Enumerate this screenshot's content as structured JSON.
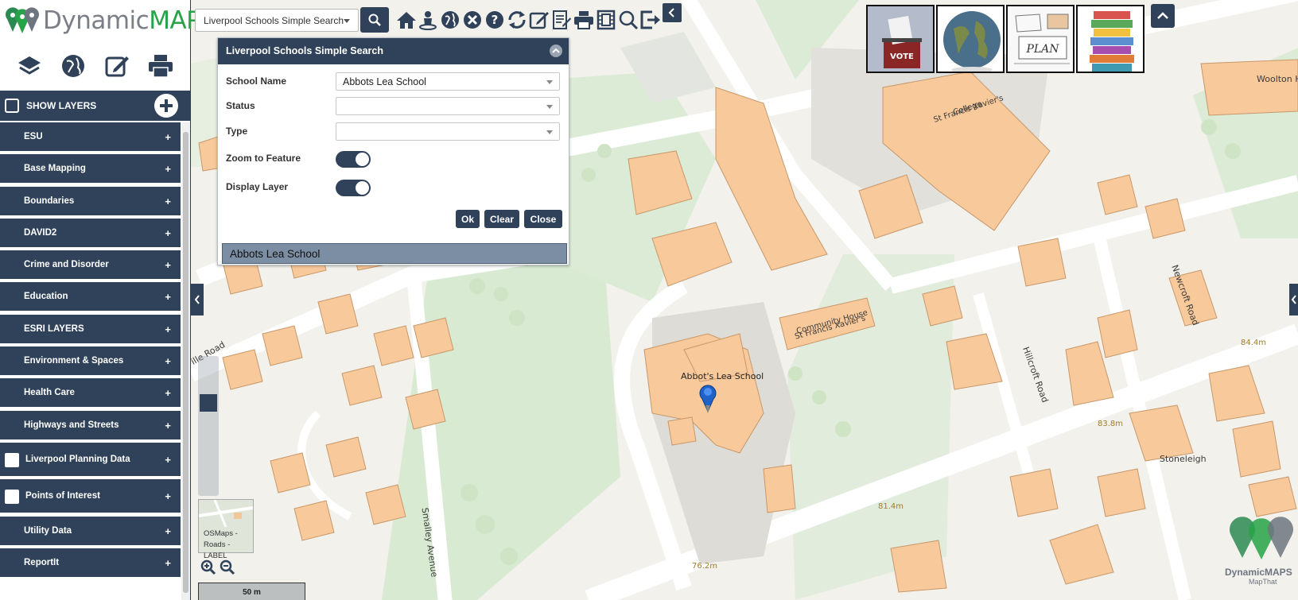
{
  "app": {
    "logo_text_1": "Dynamic",
    "logo_text_2": "MAPS",
    "brand_colors": {
      "navy": "#2f425a",
      "green": "#27a348"
    }
  },
  "toolbar_left": {
    "icons": [
      "layers-icon",
      "globe-icon",
      "edit-icon",
      "print-icon"
    ]
  },
  "show_layers": {
    "label": "SHOW LAYERS"
  },
  "layers": [
    {
      "label": "ESU",
      "checkbox": false
    },
    {
      "label": "Base Mapping",
      "checkbox": false
    },
    {
      "label": "Boundaries",
      "checkbox": false
    },
    {
      "label": "DAVID2",
      "checkbox": false
    },
    {
      "label": "Crime and Disorder",
      "checkbox": false
    },
    {
      "label": "Education",
      "checkbox": false
    },
    {
      "label": "ESRI LAYERS",
      "checkbox": false
    },
    {
      "label": "Environment & Spaces",
      "checkbox": false
    },
    {
      "label": "Health Care",
      "checkbox": false
    },
    {
      "label": "Highways and Streets",
      "checkbox": false
    },
    {
      "label": "Liverpool Planning Data",
      "checkbox": true
    },
    {
      "label": "Points of Interest",
      "checkbox": true
    },
    {
      "label": "Utility Data",
      "checkbox": false
    },
    {
      "label": "ReportIt",
      "checkbox": false
    }
  ],
  "layer_expand_symbol": "+",
  "topbar": {
    "search_selected": "Liverpool Schools Simple Search",
    "icons": [
      "search-icon",
      "home-icon",
      "user-locate-icon",
      "globe-icon",
      "clear-icon",
      "help-icon",
      "refresh-icon",
      "edit-icon",
      "list-edit-icon",
      "print-icon",
      "film-icon",
      "search-map-icon",
      "logout-icon"
    ]
  },
  "thumbnails": [
    {
      "name": "vote-thumbnail",
      "caption": "VOTE"
    },
    {
      "name": "globe-thumbnail",
      "caption": ""
    },
    {
      "name": "plan-thumbnail",
      "caption": "PLAN"
    },
    {
      "name": "books-thumbnail",
      "caption": ""
    }
  ],
  "dialog": {
    "title": "Liverpool Schools Simple Search",
    "fields": {
      "school_name_label": "School Name",
      "school_name_value": "Abbots Lea School",
      "status_label": "Status",
      "status_value": "",
      "type_label": "Type",
      "type_value": "",
      "zoom_label": "Zoom to Feature",
      "zoom_on": true,
      "display_label": "Display Layer",
      "display_on": true
    },
    "buttons": {
      "ok": "Ok",
      "clear": "Clear",
      "close": "Close"
    },
    "result": "Abbots Lea School"
  },
  "map": {
    "labels": {
      "abbots_lea": "Abbot's Lea School",
      "st_francis_college_1": "St Francis Xavier's",
      "st_francis_college_2": "College",
      "st_francis_community_1": "St Francis Xavier's",
      "st_francis_community_2": "Community House",
      "woolton": "Woolton H",
      "newcroft": "Newcroft Road",
      "hillcroft": "Hillcroft Road",
      "smalley": "Smalley Avenue",
      "stoneleigh": "Stoneleigh",
      "ille_road": "ille Road"
    },
    "elevations": {
      "e1": "84.4m",
      "e2": "83.8m",
      "e3": "81.4m",
      "e4": "76.2m"
    },
    "minimap_label_1": "OSMaps -",
    "minimap_label_2": "Roads - LABEL",
    "scale_label": "50 m",
    "watermark_1": "DynamicMAPS",
    "watermark_2": "MapThat"
  }
}
